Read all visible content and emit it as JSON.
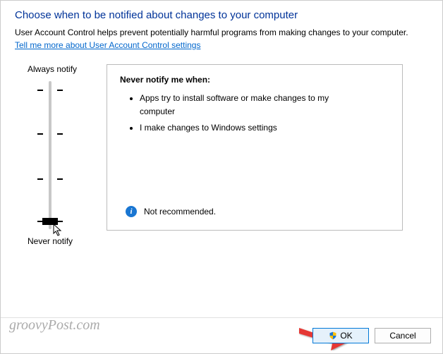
{
  "heading": "Choose when to be notified about changes to your computer",
  "subtext": "User Account Control helps prevent potentially harmful programs from making changes to your computer.",
  "help_link": "Tell me more about User Account Control settings",
  "slider": {
    "top_label": "Always notify",
    "bottom_label": "Never notify"
  },
  "panel": {
    "title": "Never notify me when:",
    "bullets": [
      "Apps try to install software or make changes to my computer",
      "I make changes to Windows settings"
    ],
    "status": "Not recommended."
  },
  "buttons": {
    "ok": "OK",
    "cancel": "Cancel"
  },
  "watermark": "groovyPost.com"
}
